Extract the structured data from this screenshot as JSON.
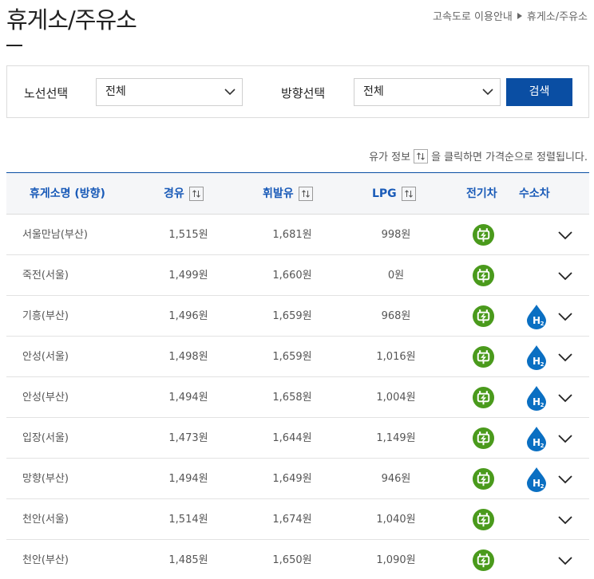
{
  "page": {
    "title": "휴게소/주유소"
  },
  "breadcrumb": {
    "items": [
      "고속도로 이용안내",
      "휴게소/주유소"
    ]
  },
  "filters": {
    "route_label": "노선선택",
    "route_value": "전체",
    "direction_label": "방향선택",
    "direction_value": "전체",
    "search_label": "검색"
  },
  "notice": {
    "before": "유가 정보",
    "after": "을 클릭하면 가격순으로 정렬됩니다."
  },
  "table": {
    "headers": {
      "name": "휴게소명 (방향)",
      "diesel": "경유",
      "gasoline": "휘발유",
      "lpg": "LPG",
      "ev": "전기차",
      "hydrogen": "수소차"
    },
    "rows": [
      {
        "name": "서울만남(부산)",
        "diesel": "1,515원",
        "gasoline": "1,681원",
        "lpg": "998원",
        "ev": true,
        "hydrogen": false
      },
      {
        "name": "죽전(서울)",
        "diesel": "1,499원",
        "gasoline": "1,660원",
        "lpg": "0원",
        "ev": true,
        "hydrogen": false
      },
      {
        "name": "기흥(부산)",
        "diesel": "1,496원",
        "gasoline": "1,659원",
        "lpg": "968원",
        "ev": true,
        "hydrogen": true
      },
      {
        "name": "안성(서울)",
        "diesel": "1,498원",
        "gasoline": "1,659원",
        "lpg": "1,016원",
        "ev": true,
        "hydrogen": true
      },
      {
        "name": "안성(부산)",
        "diesel": "1,494원",
        "gasoline": "1,658원",
        "lpg": "1,004원",
        "ev": true,
        "hydrogen": true
      },
      {
        "name": "입장(서울)",
        "diesel": "1,473원",
        "gasoline": "1,644원",
        "lpg": "1,149원",
        "ev": true,
        "hydrogen": true
      },
      {
        "name": "망향(부산)",
        "diesel": "1,494원",
        "gasoline": "1,649원",
        "lpg": "946원",
        "ev": true,
        "hydrogen": true
      },
      {
        "name": "천안(서울)",
        "diesel": "1,514원",
        "gasoline": "1,674원",
        "lpg": "1,040원",
        "ev": true,
        "hydrogen": false
      },
      {
        "name": "천안(부산)",
        "diesel": "1,485원",
        "gasoline": "1,650원",
        "lpg": "1,090원",
        "ev": true,
        "hydrogen": false
      }
    ]
  },
  "colors": {
    "accent": "#0a4ea3",
    "header_text": "#1a5bb8",
    "ev_green": "#4a9a1c",
    "h2_blue": "#0a6fc2"
  },
  "icons": {
    "ev": "ev-charger-icon",
    "hydrogen": "hydrogen-drop-icon",
    "expand": "chevron-down-icon",
    "sort": "sort-toggle-icon"
  }
}
